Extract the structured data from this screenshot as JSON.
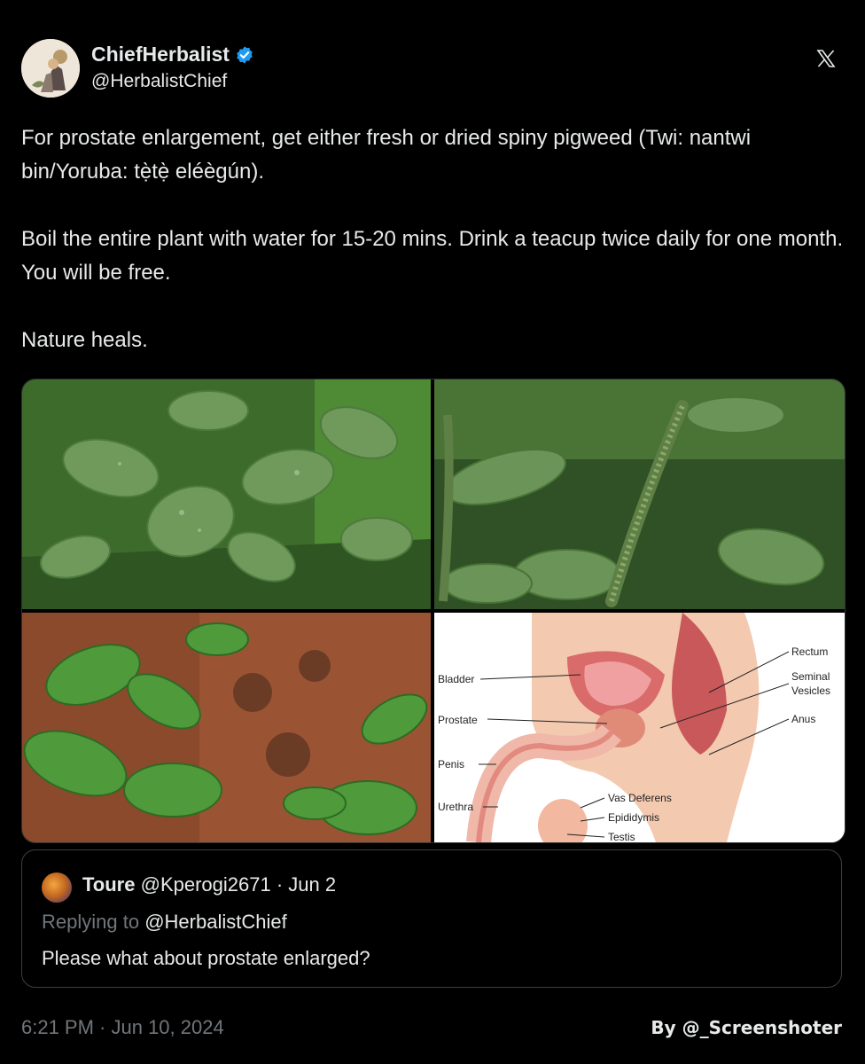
{
  "author": {
    "display_name": "ChiefHerbalist",
    "handle": "@HerbalistChief",
    "verified": true,
    "verified_color": "#1d9bf0"
  },
  "platform_icon": "x-logo-icon",
  "tweet": {
    "paragraphs": [
      "For prostate enlargement, get either fresh or dried spiny pigweed (Twi: nantwi bin/Yoruba: tẹ̀tẹ̀ eléègún).",
      "Boil the entire plant with water for 15-20 mins. Drink a teacup twice daily for one month. You will be free.",
      "Nature heals."
    ]
  },
  "media": {
    "images": [
      {
        "name": "spiny pigweed plant close-up"
      },
      {
        "name": "spiny pigweed flower spike"
      },
      {
        "name": "spiny pigweed seedlings in soil"
      },
      {
        "name": "male reproductive anatomy diagram"
      }
    ],
    "diagram_labels": {
      "rectum": "Rectum",
      "seminal_vesicles_1": "Seminal",
      "seminal_vesicles_2": "Vesicles",
      "anus": "Anus",
      "bladder": "Bladder",
      "prostate": "Prostate",
      "penis": "Penis",
      "urethra": "Urethra",
      "vas_deferens": "Vas Deferens",
      "epididymis": "Epididymis",
      "testis": "Testis"
    }
  },
  "quoted_tweet": {
    "display_name": "Toure",
    "handle": "@Kperogi2671",
    "date": "Jun 2",
    "separator": "·",
    "replying_prefix": "Replying to",
    "replying_to": "@HerbalistChief",
    "text": "Please what about prostate enlarged?"
  },
  "timestamp": "6:21 PM · Jun 10, 2024",
  "credit": "By @_Screenshoter",
  "colors": {
    "background": "#000000",
    "text": "#e7e9ea",
    "muted": "#71767b",
    "border": "#2f3336"
  }
}
